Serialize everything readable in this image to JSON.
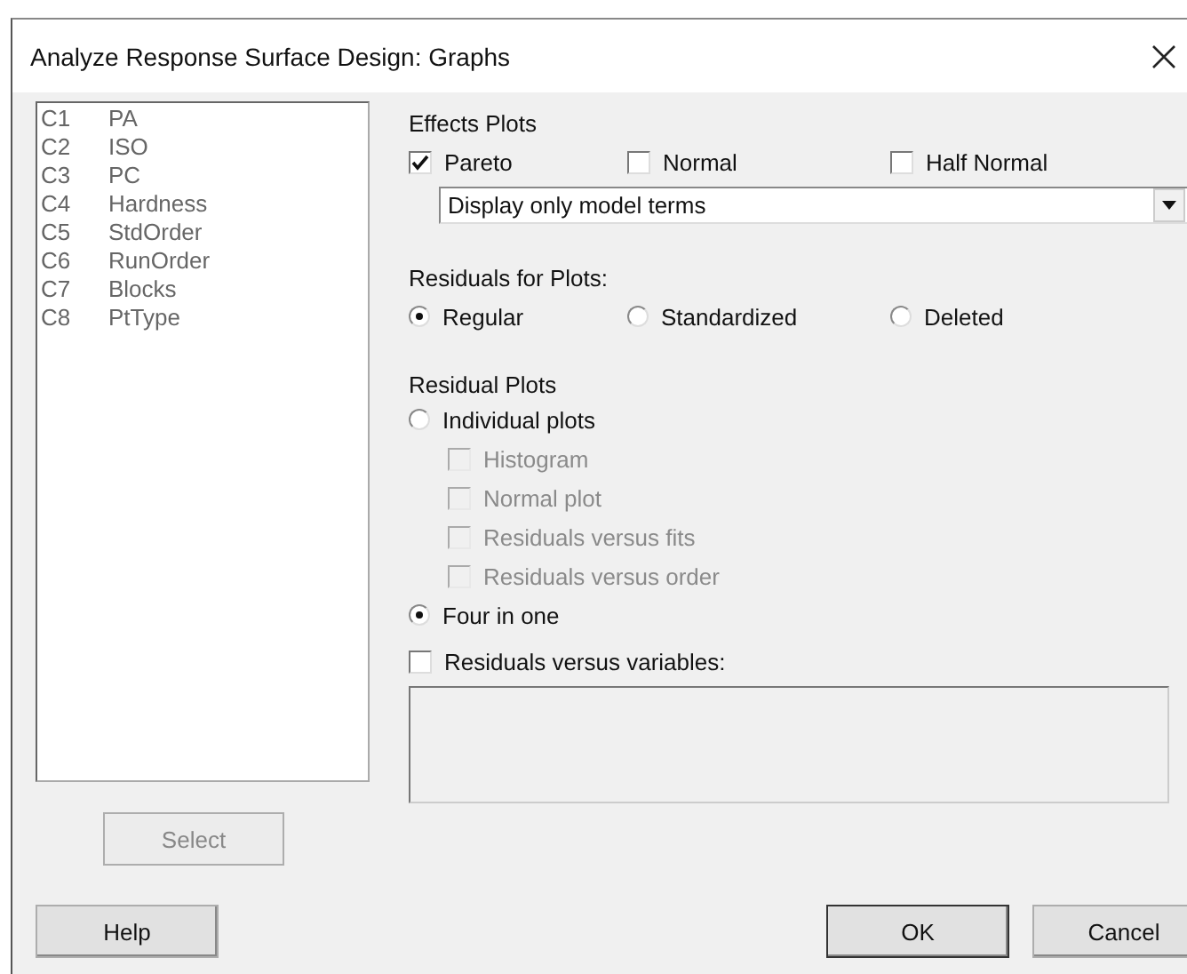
{
  "window": {
    "title": "Analyze Response Surface Design: Graphs"
  },
  "variables": [
    {
      "column": "C1",
      "name": "PA"
    },
    {
      "column": "C2",
      "name": "ISO"
    },
    {
      "column": "C3",
      "name": "PC"
    },
    {
      "column": "C4",
      "name": "Hardness"
    },
    {
      "column": "C5",
      "name": "StdOrder"
    },
    {
      "column": "C6",
      "name": "RunOrder"
    },
    {
      "column": "C7",
      "name": "Blocks"
    },
    {
      "column": "C8",
      "name": "PtType"
    }
  ],
  "select_button": {
    "label": "Select",
    "disabled": true
  },
  "effects_plots": {
    "label": "Effects Plots",
    "options": [
      {
        "label": "Pareto",
        "checked": true
      },
      {
        "label": "Normal",
        "checked": false
      },
      {
        "label": "Half Normal",
        "checked": false
      }
    ],
    "dropdown": {
      "value": "Display only model terms"
    }
  },
  "residuals_for_plots": {
    "label": "Residuals for Plots:",
    "options": [
      {
        "label": "Regular",
        "selected": true
      },
      {
        "label": "Standardized",
        "selected": false
      },
      {
        "label": "Deleted",
        "selected": false
      }
    ]
  },
  "residual_plots": {
    "label": "Residual Plots",
    "options": [
      {
        "label": "Individual plots",
        "selected": false,
        "children": [
          {
            "label": "Histogram",
            "checked": false,
            "disabled": true
          },
          {
            "label": "Normal plot",
            "checked": false,
            "disabled": true
          },
          {
            "label": "Residuals versus fits",
            "checked": false,
            "disabled": true
          },
          {
            "label": "Residuals versus order",
            "checked": false,
            "disabled": true
          }
        ]
      },
      {
        "label": "Four in one",
        "selected": true
      }
    ]
  },
  "residuals_vs_variables": {
    "label": "Residuals versus variables:",
    "checked": false
  },
  "buttons": [
    {
      "label": "Help",
      "kind": "help"
    },
    {
      "label": "OK",
      "kind": "default"
    },
    {
      "label": "Cancel",
      "kind": "normal"
    }
  ]
}
